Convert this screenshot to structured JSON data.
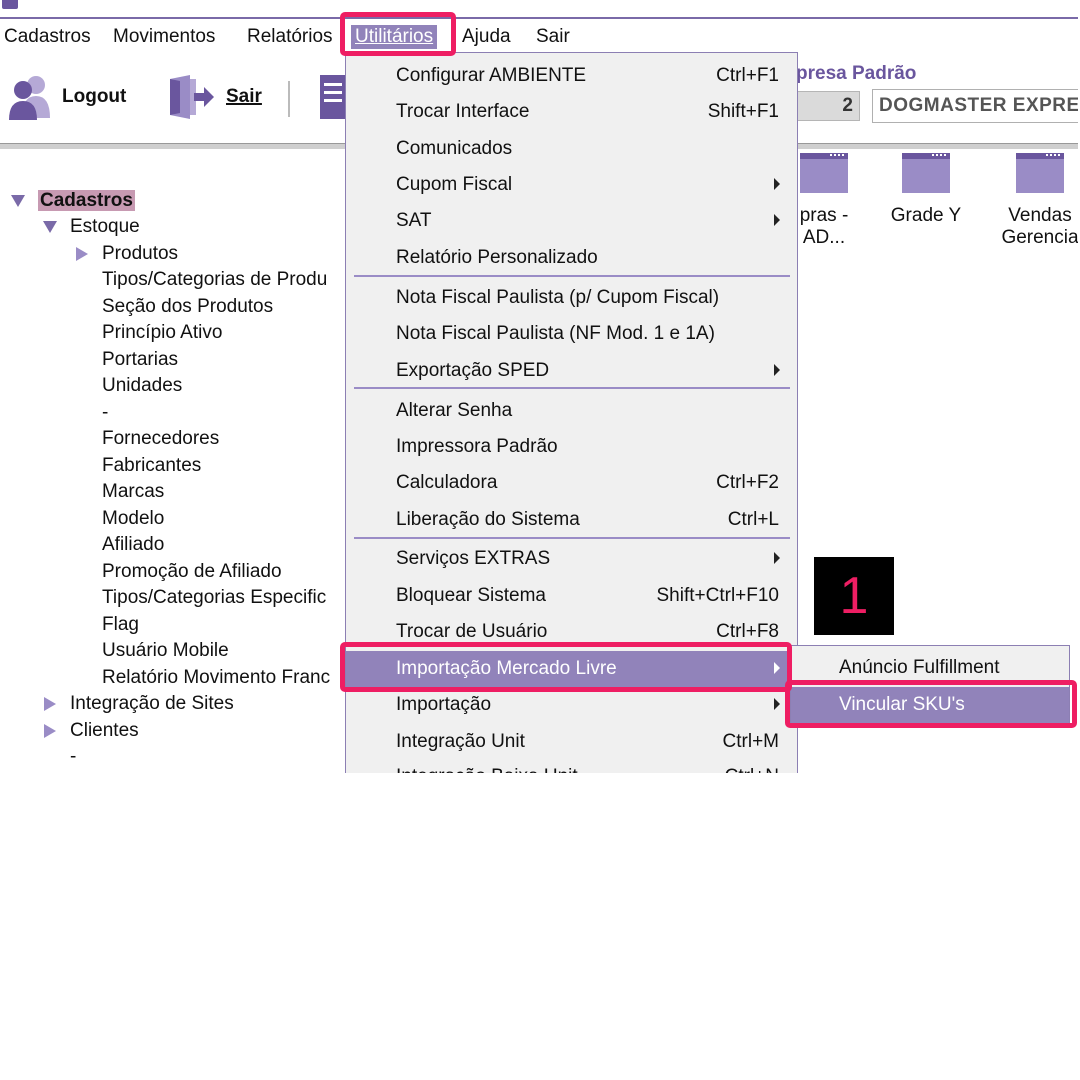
{
  "menubar": {
    "items": [
      {
        "label": "Cadastros"
      },
      {
        "label": "Movimentos"
      },
      {
        "label": "Relatórios"
      },
      {
        "label": "Utilitários"
      },
      {
        "label": "Ajuda"
      },
      {
        "label": "Sair"
      }
    ]
  },
  "toolbar": {
    "logout_label": "Logout",
    "sair_label": "Sair",
    "empresa_label": "presa Padrão",
    "empresa_number": "2",
    "empresa_name": "DOGMASTER EXPRE"
  },
  "tree": {
    "root": "Cadastros",
    "estoque": "Estoque",
    "produtos": "Produtos",
    "children": [
      "Tipos/Categorias de Produ",
      "Seção dos Produtos",
      "Princípio Ativo",
      "Portarias",
      "Unidades",
      "-",
      "Fornecedores",
      "Fabricantes",
      "Marcas",
      "Modelo",
      "Afiliado",
      "Promoção de Afiliado",
      "Tipos/Categorias Especific",
      "Flag",
      "Usuário Mobile",
      "Relatório Movimento Franc"
    ],
    "integracao": "Integração de Sites",
    "clientes": "Clientes",
    "dash": "-"
  },
  "desktop": {
    "icons": [
      {
        "line1": "pras -",
        "line2": "AD..."
      },
      {
        "line1": "Grade Y",
        "line2": ""
      },
      {
        "line1": "Vendas",
        "line2": "Gerencia"
      }
    ]
  },
  "dropdown": {
    "items": [
      {
        "label": "Configurar AMBIENTE",
        "shortcut": "Ctrl+F1"
      },
      {
        "label": "Trocar Interface",
        "shortcut": "Shift+F1"
      },
      {
        "label": "Comunicados",
        "shortcut": ""
      },
      {
        "label": "Cupom Fiscal",
        "shortcut": ""
      },
      {
        "label": "SAT",
        "shortcut": ""
      },
      {
        "label": "Relatório Personalizado",
        "shortcut": ""
      },
      {
        "label": "Nota Fiscal Paulista (p/ Cupom Fiscal)",
        "shortcut": ""
      },
      {
        "label": "Nota Fiscal Paulista (NF Mod. 1 e 1A)",
        "shortcut": ""
      },
      {
        "label": "Exportação SPED",
        "shortcut": ""
      },
      {
        "label": "Alterar Senha",
        "shortcut": ""
      },
      {
        "label": "Impressora Padrão",
        "shortcut": ""
      },
      {
        "label": "Calculadora",
        "shortcut": "Ctrl+F2"
      },
      {
        "label": "Liberação do Sistema",
        "shortcut": "Ctrl+L"
      },
      {
        "label": "Serviços EXTRAS",
        "shortcut": ""
      },
      {
        "label": "Bloquear Sistema",
        "shortcut": "Shift+Ctrl+F10"
      },
      {
        "label": "Trocar de Usuário",
        "shortcut": "Ctrl+F8"
      },
      {
        "label": "Importação Mercado Livre",
        "shortcut": ""
      },
      {
        "label": "Importação",
        "shortcut": ""
      },
      {
        "label": "Integração Unit",
        "shortcut": "Ctrl+M"
      },
      {
        "label": "Integração Baixa Unit",
        "shortcut": "Ctrl+N"
      }
    ]
  },
  "submenu": {
    "items": [
      {
        "label": "Anúncio Fulfillment"
      },
      {
        "label": "Vincular SKU's"
      }
    ]
  },
  "annotation": {
    "step": "1"
  },
  "colors": {
    "accent": "#9183ba",
    "accent_dark": "#6a569e",
    "callout": "#ee1e63",
    "tree_selected": "#c79ab2"
  }
}
